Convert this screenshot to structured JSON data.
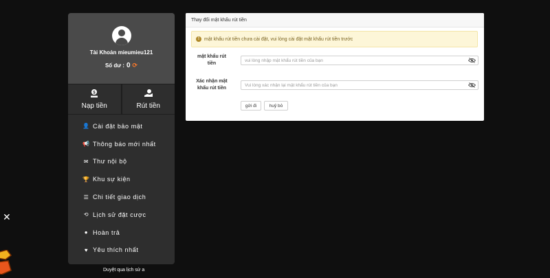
{
  "sidebar": {
    "account_label": "Tài Khoản mieumieu121",
    "balance_label": "Số dư :",
    "balance_value": "0",
    "actions": [
      {
        "label": "Nạp tiền",
        "icon": "deposit-icon"
      },
      {
        "label": "Rút tiền",
        "icon": "withdraw-icon"
      }
    ],
    "items": [
      {
        "label": "Cài đặt bảo mật",
        "icon": "user-lock-icon"
      },
      {
        "label": "Thông báo mới nhất",
        "icon": "megaphone-icon"
      },
      {
        "label": "Thư nội bộ",
        "icon": "envelope-icon"
      },
      {
        "label": "Khu sự kiện",
        "icon": "trophy-icon"
      },
      {
        "label": "Chi tiết giao dịch",
        "icon": "list-icon"
      },
      {
        "label": "Lịch sử đặt cược",
        "icon": "history-icon"
      },
      {
        "label": "Hoàn trả",
        "icon": "coin-icon"
      },
      {
        "label": "Yêu thích nhất",
        "icon": "heart-icon"
      }
    ]
  },
  "footer_text": "Duyệt qua lịch sử a",
  "panel": {
    "title": "Thay đổi mật khẩu rút tiền",
    "alert": "mật khẩu rút tiền chưa cài đặt, vui lòng cài đặt mật khẩu rút tiền trước",
    "fields": [
      {
        "label_line1": "mật khẩu rút",
        "label_line2": "tiền",
        "placeholder": "vui lòng nhập mật khẩu rút tiền của bạn"
      },
      {
        "label_line1": "Xác nhận mật",
        "label_line2": "khẩu rút tiền",
        "placeholder": "Vui lòng xác nhận lại mật khẩu rút tiền của bạn"
      }
    ],
    "submit_label": "gửi đi",
    "cancel_label": "huỷ bỏ"
  },
  "colors": {
    "accent_refresh": "#ff7a2a",
    "alert_bg": "#fdf6d8",
    "alert_text": "#7a6320"
  }
}
